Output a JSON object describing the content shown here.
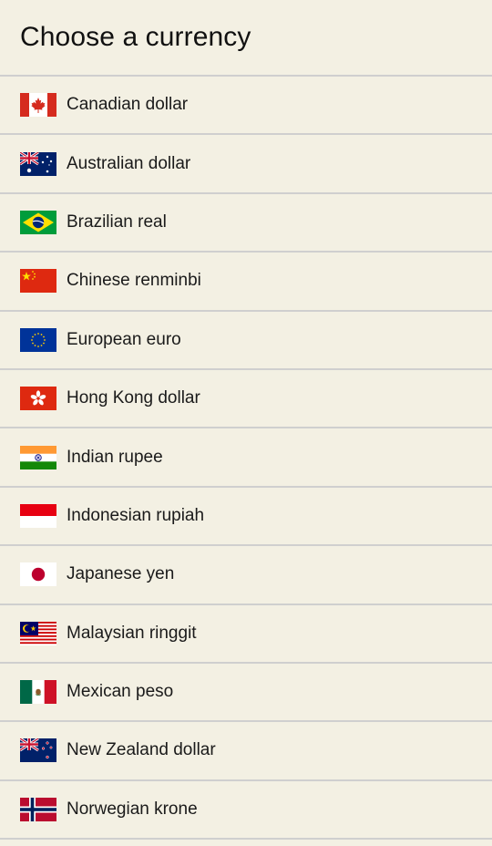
{
  "header": {
    "title": "Choose a currency"
  },
  "currencies": [
    {
      "name": "Canadian dollar",
      "flag_icon": "flag-canada-icon"
    },
    {
      "name": "Australian dollar",
      "flag_icon": "flag-australia-icon"
    },
    {
      "name": "Brazilian real",
      "flag_icon": "flag-brazil-icon"
    },
    {
      "name": "Chinese renminbi",
      "flag_icon": "flag-china-icon"
    },
    {
      "name": "European euro",
      "flag_icon": "flag-eu-icon"
    },
    {
      "name": "Hong Kong dollar",
      "flag_icon": "flag-hong-kong-icon"
    },
    {
      "name": "Indian rupee",
      "flag_icon": "flag-india-icon"
    },
    {
      "name": "Indonesian rupiah",
      "flag_icon": "flag-indonesia-icon"
    },
    {
      "name": "Japanese yen",
      "flag_icon": "flag-japan-icon"
    },
    {
      "name": "Malaysian ringgit",
      "flag_icon": "flag-malaysia-icon"
    },
    {
      "name": "Mexican peso",
      "flag_icon": "flag-mexico-icon"
    },
    {
      "name": "New Zealand dollar",
      "flag_icon": "flag-new-zealand-icon"
    },
    {
      "name": "Norwegian krone",
      "flag_icon": "flag-norway-icon"
    }
  ],
  "colors": {
    "background": "#f3f0e3",
    "divider": "#cfcfcf",
    "text": "#111111"
  }
}
